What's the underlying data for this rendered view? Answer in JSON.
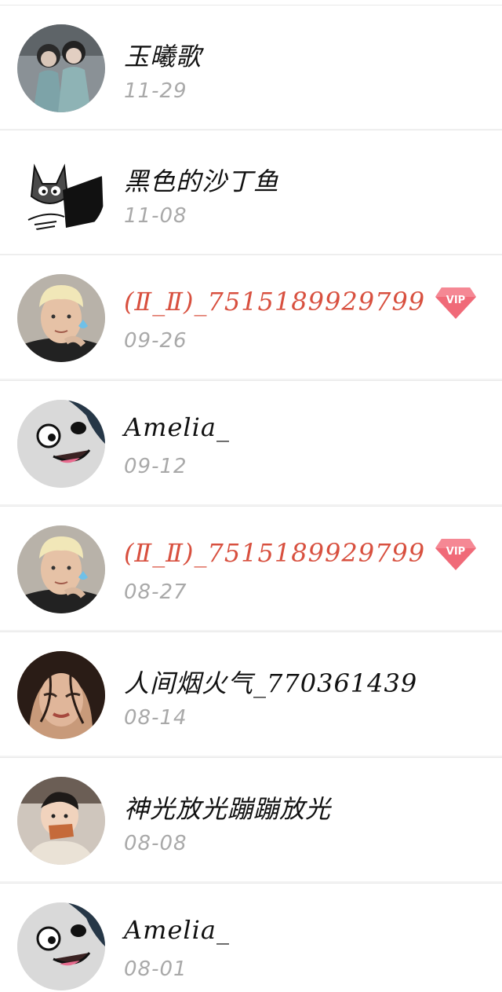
{
  "contacts": [
    {
      "name": "玉曦歌",
      "date": "11-29",
      "vip": false,
      "avatar": "two-girls-photo"
    },
    {
      "name": "黑色的沙丁鱼",
      "date": "11-08",
      "vip": false,
      "avatar": "cat-laptop-cartoon"
    },
    {
      "name": "(Ⅱ_Ⅱ)_7515189929799",
      "date": "09-26",
      "vip": true,
      "avatar": "blond-boy-photo"
    },
    {
      "name": "Amelia_",
      "date": "09-12",
      "vip": false,
      "avatar": "panda-cartoon"
    },
    {
      "name": "(Ⅱ_Ⅱ)_7515189929799",
      "date": "08-27",
      "vip": true,
      "avatar": "blond-boy-photo"
    },
    {
      "name": "人间烟火气_770361439",
      "date": "08-14",
      "vip": false,
      "avatar": "woman-portrait-photo"
    },
    {
      "name": "神光放光蹦蹦放光",
      "date": "08-08",
      "vip": false,
      "avatar": "baby-eating-photo"
    },
    {
      "name": "Amelia_",
      "date": "08-01",
      "vip": false,
      "avatar": "panda-cartoon"
    }
  ],
  "vip_badge_label": "VIP",
  "colors": {
    "vip_name": "#d8503f",
    "date": "#a9a9a9",
    "badge": "#f06a78"
  }
}
